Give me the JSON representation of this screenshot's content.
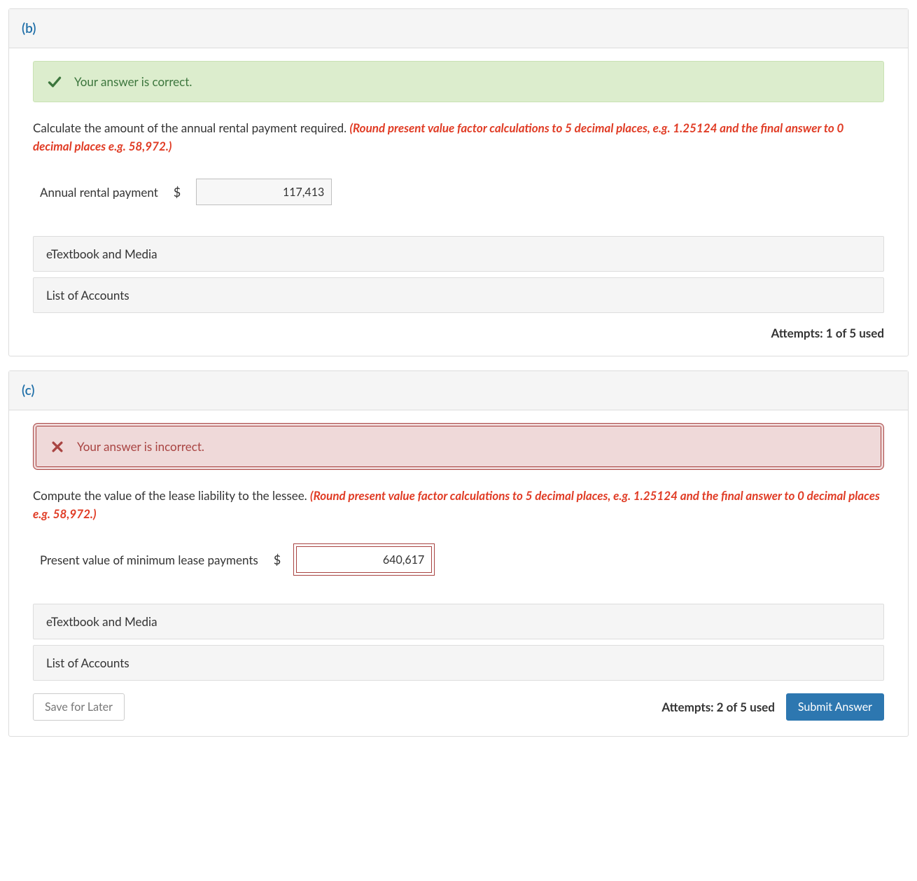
{
  "partB": {
    "label": "(b)",
    "alert": {
      "status": "correct",
      "message": "Your answer is correct."
    },
    "prompt_text": "Calculate the amount of the annual rental payment required. ",
    "prompt_hint": "(Round present value factor calculations to 5 decimal places, e.g. 1.25124 and the final answer to 0 decimal places e.g. 58,972.)",
    "input": {
      "label": "Annual rental payment",
      "currency": "$",
      "value": "117,413"
    },
    "subpanels": [
      "eTextbook and Media",
      "List of Accounts"
    ],
    "attempts": "Attempts: 1 of 5 used"
  },
  "partC": {
    "label": "(c)",
    "alert": {
      "status": "incorrect",
      "message": "Your answer is incorrect."
    },
    "prompt_text": "Compute the value of the lease liability to the lessee. ",
    "prompt_hint": "(Round present value factor calculations to 5 decimal places, e.g. 1.25124 and the final answer to 0 decimal places e.g. 58,972.)",
    "input": {
      "label": "Present value of minimum lease payments",
      "currency": "$",
      "value": "640,617"
    },
    "subpanels": [
      "eTextbook and Media",
      "List of Accounts"
    ],
    "attempts": "Attempts: 2 of 5 used",
    "buttons": {
      "save": "Save for Later",
      "submit": "Submit Answer"
    }
  }
}
